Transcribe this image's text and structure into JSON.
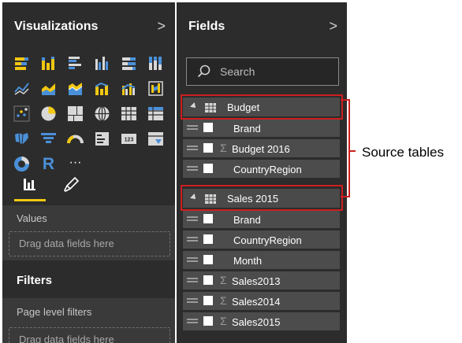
{
  "visualizations": {
    "title": "Visualizations",
    "chevron": ">",
    "icon_names": [
      "stacked-bar-chart-icon",
      "stacked-column-chart-icon",
      "clustered-bar-chart-icon",
      "clustered-column-chart-icon",
      "100-stacked-bar-chart-icon",
      "100-stacked-column-chart-icon",
      "line-chart-icon",
      "area-chart-icon",
      "stacked-area-chart-icon",
      "line-and-stacked-column-chart-icon",
      "line-and-clustered-column-chart-icon",
      "ribbon-chart-icon",
      "scatter-chart-icon",
      "pie-chart-icon",
      "treemap-icon",
      "map-icon",
      "table-icon",
      "matrix-icon",
      "filled-map-icon",
      "funnel-icon",
      "gauge-icon",
      "multi-row-card-icon",
      "card-icon",
      "slicer-icon",
      "donut-chart-icon",
      "r-script-visual-icon",
      "more-visuals-icon"
    ],
    "r_label": "R",
    "more_label": "···",
    "tabs": [
      "fields-tab-icon",
      "format-tab-icon"
    ],
    "values_label": "Values",
    "drag_text": "Drag data fields here",
    "filters_title": "Filters",
    "page_filters_label": "Page level filters",
    "page_drag_text": "Drag data fields here"
  },
  "fields": {
    "title": "Fields",
    "chevron": ">",
    "search_placeholder": "Search",
    "tables": [
      {
        "name": "Budget",
        "fields": [
          {
            "name": "Brand",
            "sigma": false
          },
          {
            "name": "Budget 2016",
            "sigma": true
          },
          {
            "name": "CountryRegion",
            "sigma": false
          }
        ]
      },
      {
        "name": "Sales 2015",
        "fields": [
          {
            "name": "Brand",
            "sigma": false
          },
          {
            "name": "CountryRegion",
            "sigma": false
          },
          {
            "name": "Month",
            "sigma": false
          },
          {
            "name": "Sales2013",
            "sigma": true
          },
          {
            "name": "Sales2014",
            "sigma": true
          },
          {
            "name": "Sales2015",
            "sigma": true
          }
        ]
      }
    ]
  },
  "annotation": {
    "text": "Source tables",
    "color": "#cc1f1f"
  },
  "colors": {
    "accent": "#f2c811",
    "highlight": "#cc1f1f",
    "pane_bg": "#2c2c2c"
  }
}
